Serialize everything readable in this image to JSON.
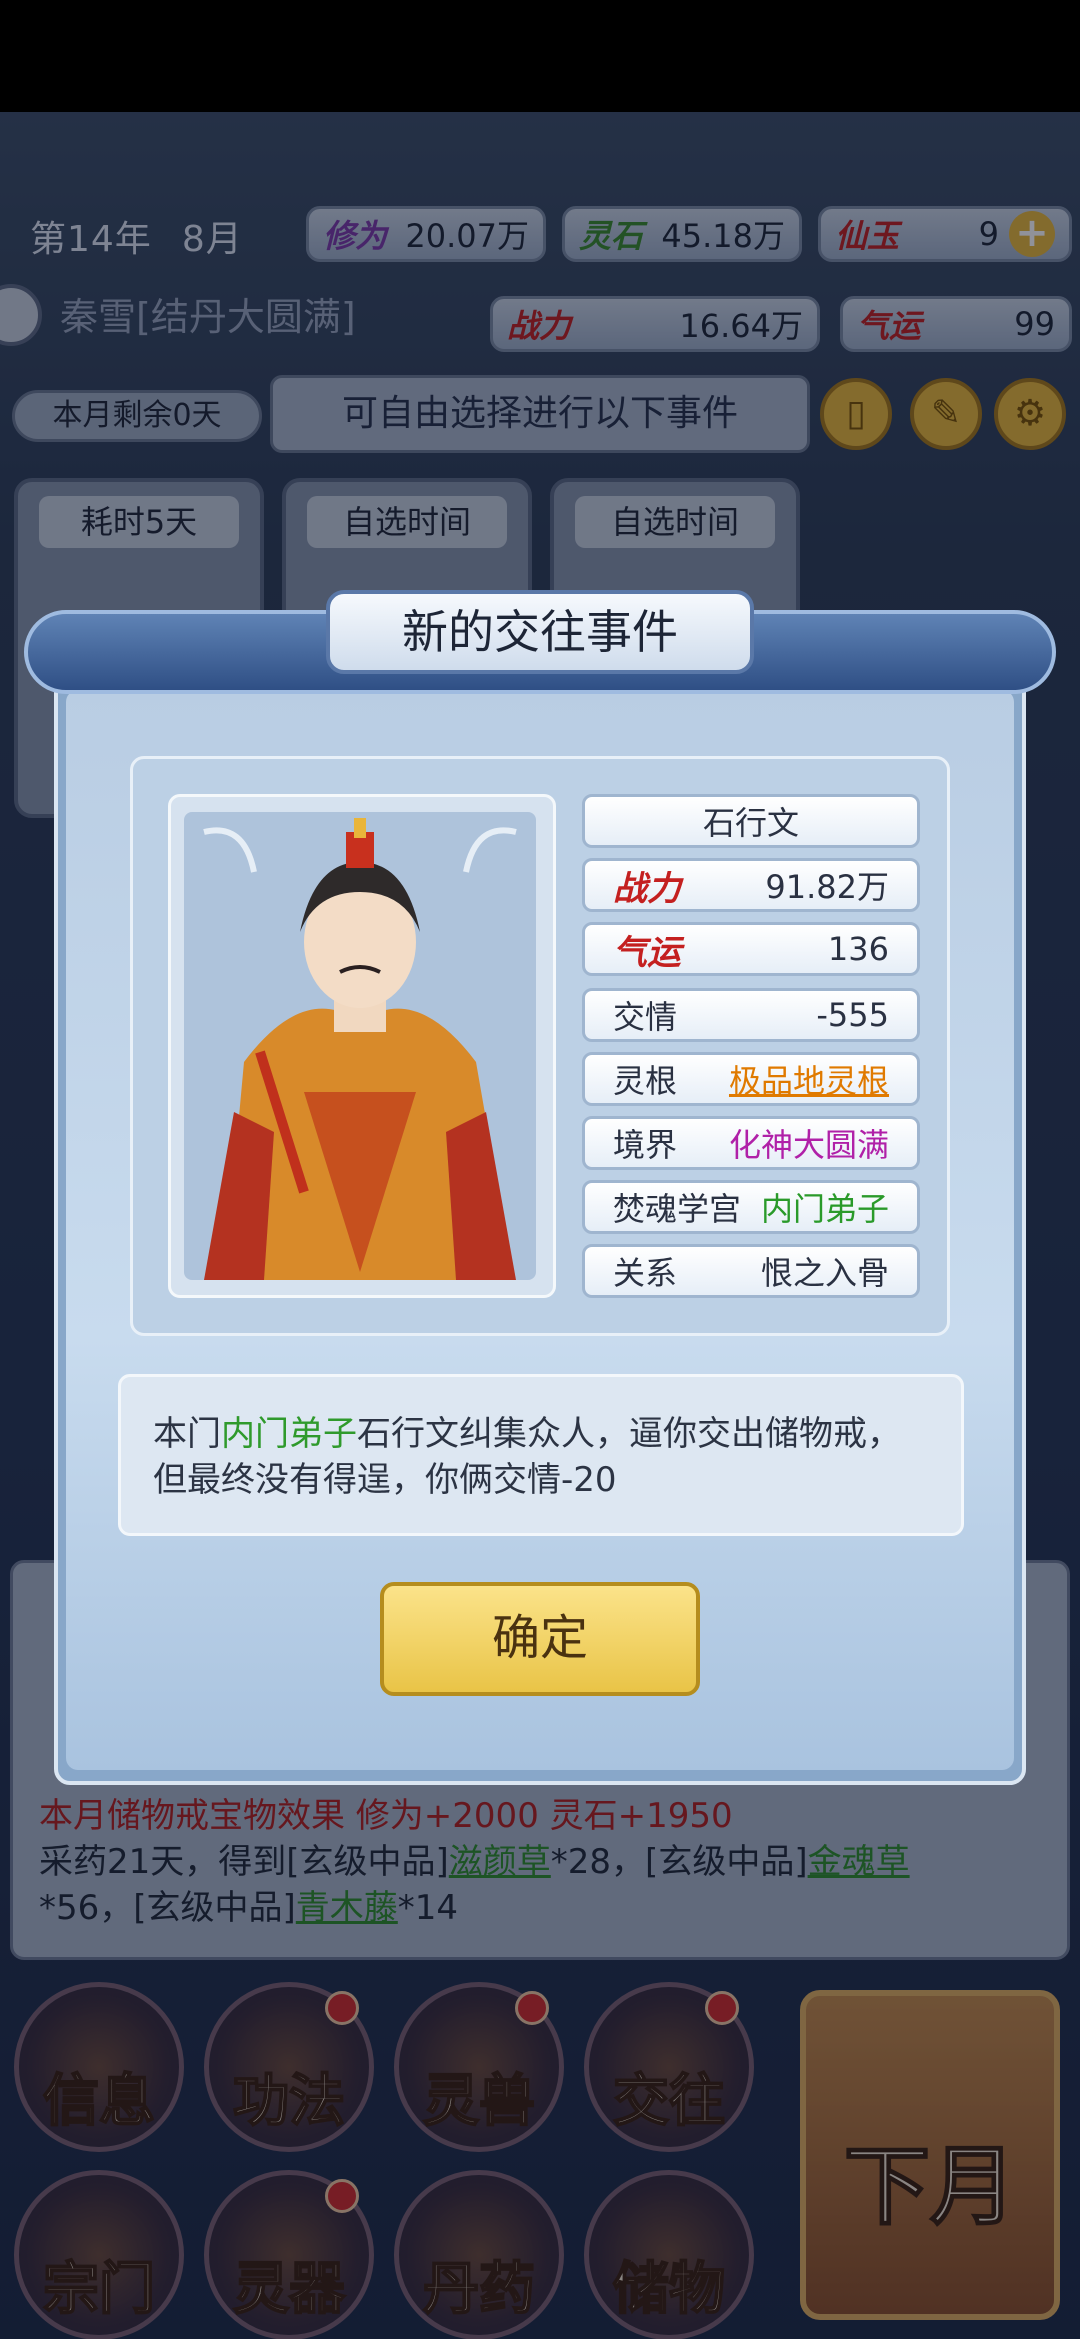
{
  "hud": {
    "year": "第14年",
    "month": "8月",
    "cultivation_label": "修为",
    "cultivation_value": "20.07万",
    "spirit_stone_label": "灵石",
    "spirit_stone_value": "45.18万",
    "jade_label": "仙玉",
    "jade_value": "9",
    "plus": "+",
    "character_name": "秦雪[结丹大圆满]",
    "power_label": "战力",
    "power_value": "16.64万",
    "luck_label": "气运",
    "luck_value": "99",
    "days_left": "本月剩余0天",
    "event_banner": "可自由选择进行以下事件",
    "cards": [
      "耗时5天",
      "自选时间",
      "自选时间"
    ]
  },
  "modal": {
    "title": "新的交往事件",
    "npc": {
      "name": "石行文",
      "rows": [
        {
          "key": "战力",
          "value": "91.82万"
        },
        {
          "key": "气运",
          "value": "136"
        },
        {
          "key": "交情",
          "value": "-555"
        },
        {
          "key": "灵根",
          "value": "极品地灵根"
        },
        {
          "key": "境界",
          "value": "化神大圆满"
        },
        {
          "key": "焚魂学宫",
          "value": "内门弟子"
        },
        {
          "key": "关系",
          "value": "恨之入骨"
        }
      ]
    },
    "message": {
      "p1": "本门",
      "p2": "内门弟子",
      "p3": "石行文纠集众人，逼你交出储物戒，",
      "p4": "但最终没有得逞，你俩交情-20"
    },
    "confirm": "确定"
  },
  "log": {
    "line1": "本月储物戒宝物效果 修为+2000 灵石+1950",
    "l2a": "采药21天，得到[玄级中品]",
    "l2b": "滋颜草",
    "l2c": "*28，[玄级中品]",
    "l2d": "金魂草",
    "l3a": "*56，[玄级中品]",
    "l3b": "青木藤",
    "l3c": "*14"
  },
  "menu": {
    "row1": [
      "信息",
      "功法",
      "灵兽",
      "交往"
    ],
    "row2": [
      "宗门",
      "灵器",
      "丹药",
      "储物"
    ],
    "next_month": "下月"
  }
}
